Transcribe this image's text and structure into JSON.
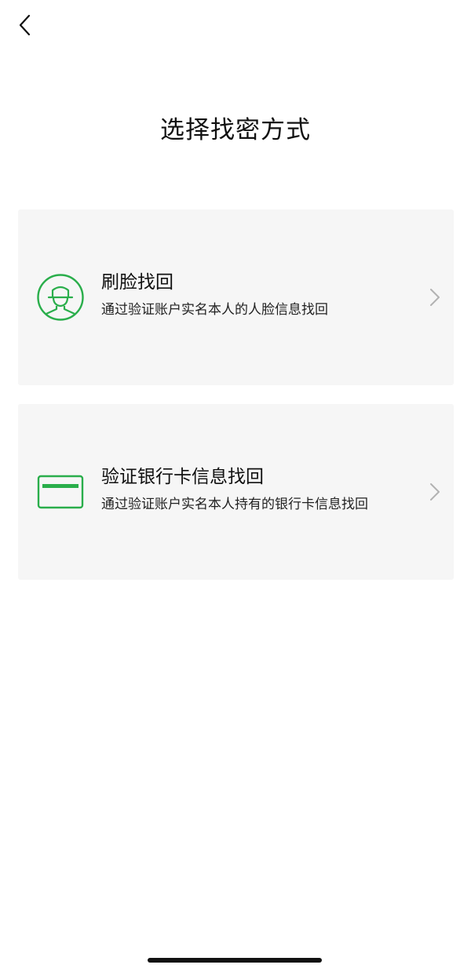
{
  "header": {
    "back_icon": "chevron-left-icon",
    "title": "选择找密方式"
  },
  "options": [
    {
      "icon": "face-recognition-icon",
      "title": "刷脸找回",
      "description": "通过验证账户实名本人的人脸信息找回"
    },
    {
      "icon": "bank-card-icon",
      "title": "验证银行卡信息找回",
      "description": "通过验证账户实名本人持有的银行卡信息找回"
    }
  ],
  "colors": {
    "accent": "#2aae4b",
    "card_background": "#f6f6f6",
    "chevron": "#b2b2b2",
    "text_primary": "#111111"
  }
}
